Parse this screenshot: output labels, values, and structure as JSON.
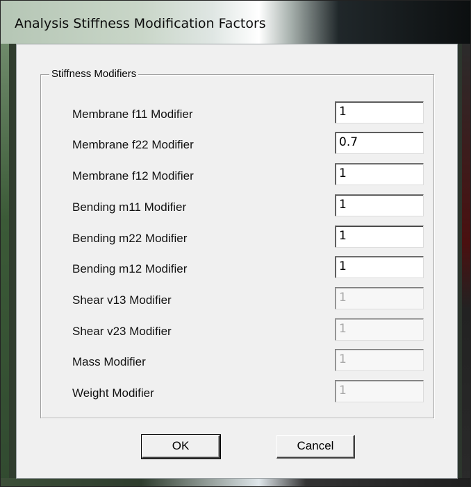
{
  "window": {
    "title": "Analysis Stiffness Modification Factors"
  },
  "group": {
    "legend": "Stiffness Modifiers",
    "rows": [
      {
        "label": "Membrane f11 Modifier",
        "value": "1",
        "enabled": true
      },
      {
        "label": "Membrane f22 Modifier",
        "value": "0.7",
        "enabled": true
      },
      {
        "label": "Membrane f12 Modifier",
        "value": "1",
        "enabled": true
      },
      {
        "label": "Bending  m11 Modifier",
        "value": "1",
        "enabled": true
      },
      {
        "label": "Bending  m22 Modifier",
        "value": "1",
        "enabled": true
      },
      {
        "label": "Bending  m12 Modifier",
        "value": "1",
        "enabled": true
      },
      {
        "label": "Shear  v13 Modifier",
        "value": "1",
        "enabled": false
      },
      {
        "label": "Shear  v23 Modifier",
        "value": "1",
        "enabled": false
      },
      {
        "label": "Mass Modifier",
        "value": "1",
        "enabled": false
      },
      {
        "label": "Weight Modifier",
        "value": "1",
        "enabled": false
      }
    ]
  },
  "buttons": {
    "ok": "OK",
    "cancel": "Cancel"
  }
}
